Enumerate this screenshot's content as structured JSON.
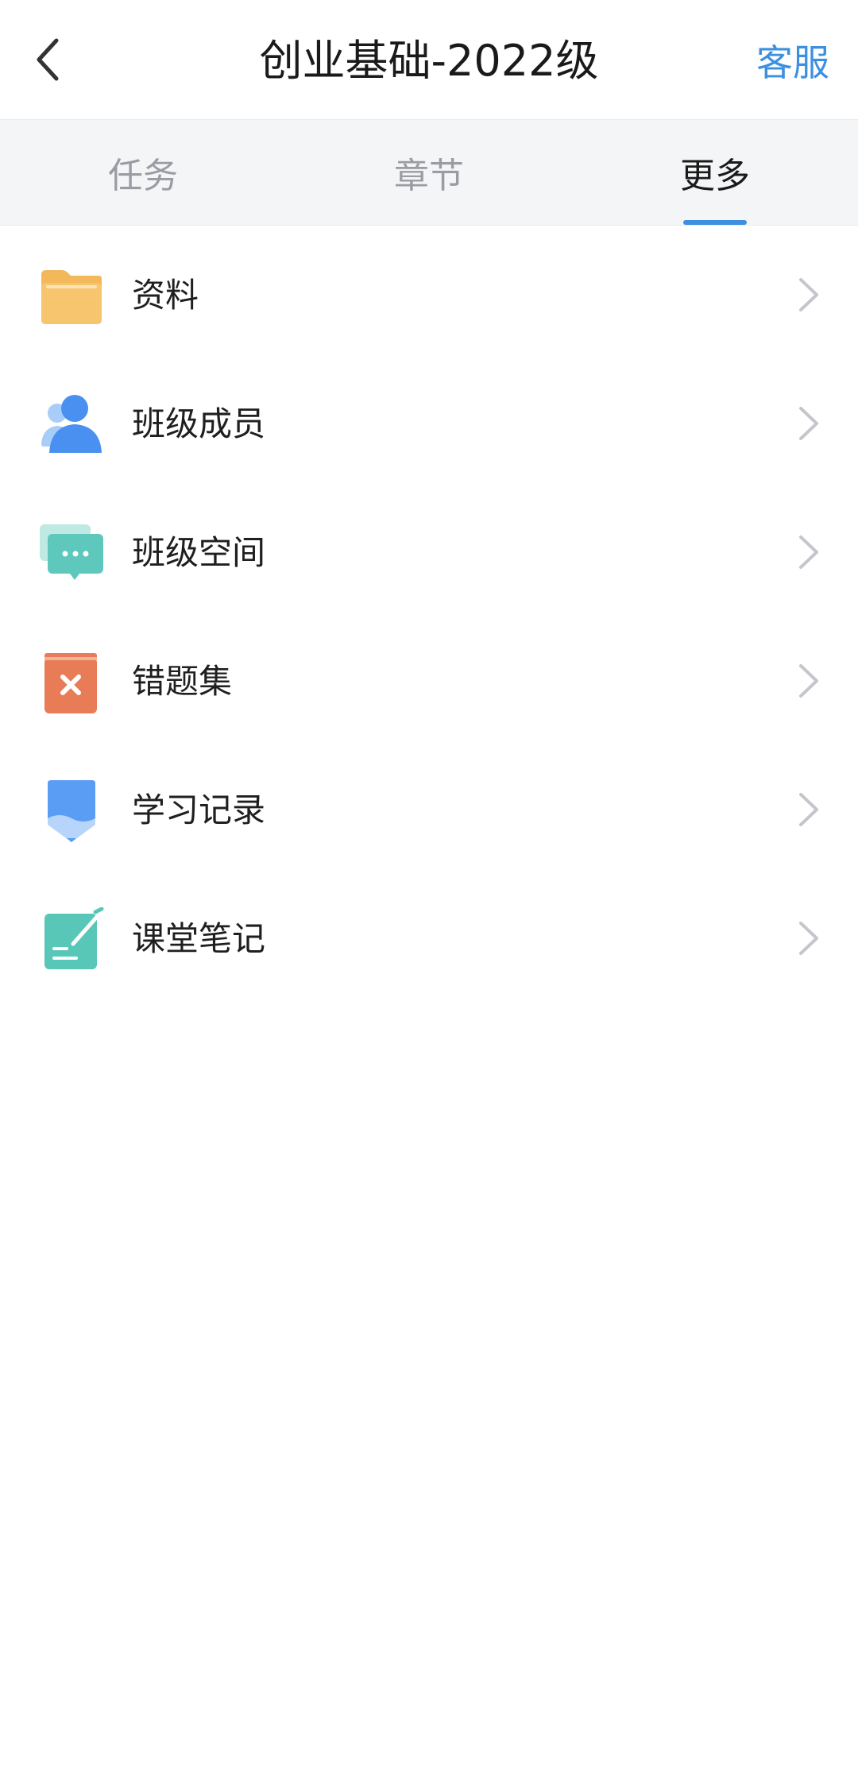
{
  "header": {
    "title": "创业基础-2022级",
    "back_icon": "chevron-left-icon",
    "service_label": "客服",
    "service_color": "#3d8fe0"
  },
  "tabs": [
    {
      "label": "任务",
      "active": false
    },
    {
      "label": "章节",
      "active": false
    },
    {
      "label": "更多",
      "active": true
    }
  ],
  "list": {
    "items": [
      {
        "label": "资料",
        "icon": "folder-icon",
        "icon_color": "#f4bc5f"
      },
      {
        "label": "班级成员",
        "icon": "members-icon",
        "icon_color": "#4a90f0"
      },
      {
        "label": "班级空间",
        "icon": "chat-bubble-icon",
        "icon_color": "#5ec8bd"
      },
      {
        "label": "错题集",
        "icon": "wrong-book-icon",
        "icon_color": "#e87c57"
      },
      {
        "label": "学习记录",
        "icon": "pencil-record-icon",
        "icon_color": "#5a9df5"
      },
      {
        "label": "课堂笔记",
        "icon": "note-icon",
        "icon_color": "#59c7b8"
      }
    ],
    "chevron_icon": "chevron-right-icon"
  }
}
